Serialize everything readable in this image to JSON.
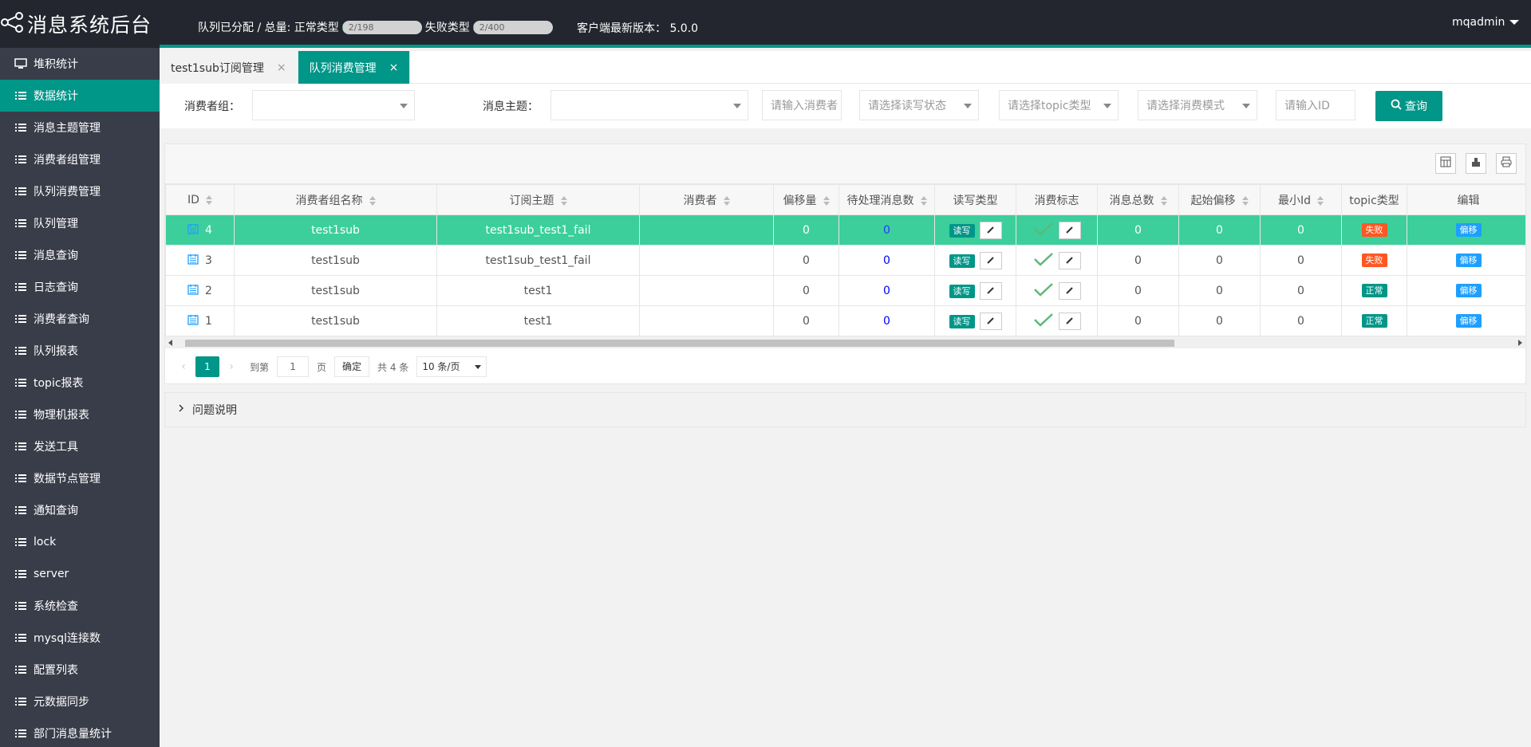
{
  "header": {
    "title": "消息系统后台",
    "queue_label": "队列已分配 / 总量: 正常类型",
    "normal_progress": {
      "text": "2/198",
      "value": 0.0101
    },
    "fail_label": "失败类型",
    "fail_progress": {
      "text": "2/400",
      "value": 0.005
    },
    "version_label": "客户端最新版本： 5.0.0",
    "user": "mqadmin"
  },
  "sidebar": {
    "items": [
      {
        "label": "堆积统计",
        "icon": "monitor-icon",
        "active": false
      },
      {
        "label": "数据统计",
        "icon": "list-icon",
        "active": true
      },
      {
        "label": "消息主题管理",
        "icon": "list-icon",
        "active": false
      },
      {
        "label": "消费者组管理",
        "icon": "list-icon",
        "active": false
      },
      {
        "label": "队列消费管理",
        "icon": "list-icon",
        "active": false
      },
      {
        "label": "队列管理",
        "icon": "list-icon",
        "active": false
      },
      {
        "label": "消息查询",
        "icon": "list-icon",
        "active": false
      },
      {
        "label": "日志查询",
        "icon": "list-icon",
        "active": false
      },
      {
        "label": "消费者查询",
        "icon": "list-icon",
        "active": false
      },
      {
        "label": "队列报表",
        "icon": "list-icon",
        "active": false
      },
      {
        "label": "topic报表",
        "icon": "list-icon",
        "active": false
      },
      {
        "label": "物理机报表",
        "icon": "list-icon",
        "active": false
      },
      {
        "label": "发送工具",
        "icon": "list-icon",
        "active": false
      },
      {
        "label": "数据节点管理",
        "icon": "list-icon",
        "active": false
      },
      {
        "label": "通知查询",
        "icon": "list-icon",
        "active": false
      },
      {
        "label": "lock",
        "icon": "list-icon",
        "active": false
      },
      {
        "label": "server",
        "icon": "list-icon",
        "active": false
      },
      {
        "label": "系统检查",
        "icon": "list-icon",
        "active": false
      },
      {
        "label": "mysql连接数",
        "icon": "list-icon",
        "active": false
      },
      {
        "label": "配置列表",
        "icon": "list-icon",
        "active": false
      },
      {
        "label": "元数据同步",
        "icon": "list-icon",
        "active": false
      },
      {
        "label": "部门消息量统计",
        "icon": "list-icon",
        "active": false
      }
    ]
  },
  "tabs": [
    {
      "label": "test1sub订阅管理",
      "active": false
    },
    {
      "label": "队列消费管理",
      "active": true
    }
  ],
  "search": {
    "consumer_group_label": "消费者组：",
    "topic_label": "消息主题：",
    "consumer_placeholder": "请输入消费者",
    "rw_placeholder": "请选择读写状态",
    "topic_type_placeholder": "请选择topic类型",
    "mode_placeholder": "请选择消费模式",
    "id_placeholder": "请输入ID",
    "button": "查询"
  },
  "table": {
    "columns": [
      "ID",
      "消费者组名称",
      "订阅主题",
      "消费者",
      "偏移量",
      "待处理消息数",
      "读写类型",
      "消费标志",
      "消息总数",
      "起始偏移",
      "最小Id",
      "topic类型",
      "编辑"
    ],
    "rows": [
      {
        "id": "4",
        "group": "test1sub",
        "topic": "test1sub_test1_fail",
        "consumer": "",
        "offset": "0",
        "pending": "0",
        "rw": "读写",
        "total": "0",
        "start": "0",
        "min_id": "0",
        "topic_type": "失败",
        "edit": "偏移",
        "selected": true
      },
      {
        "id": "3",
        "group": "test1sub",
        "topic": "test1sub_test1_fail",
        "consumer": "",
        "offset": "0",
        "pending": "0",
        "rw": "读写",
        "total": "0",
        "start": "0",
        "min_id": "0",
        "topic_type": "失败",
        "edit": "偏移",
        "selected": false
      },
      {
        "id": "2",
        "group": "test1sub",
        "topic": "test1",
        "consumer": "",
        "offset": "0",
        "pending": "0",
        "rw": "读写",
        "total": "0",
        "start": "0",
        "min_id": "0",
        "topic_type": "正常",
        "edit": "偏移",
        "selected": false
      },
      {
        "id": "1",
        "group": "test1sub",
        "topic": "test1",
        "consumer": "",
        "offset": "0",
        "pending": "0",
        "rw": "读写",
        "total": "0",
        "start": "0",
        "min_id": "0",
        "topic_type": "正常",
        "edit": "偏移",
        "selected": false
      }
    ]
  },
  "pager": {
    "current": "1",
    "goto_label": "到第",
    "page_input": "1",
    "page_unit": "页",
    "confirm": "确定",
    "total": "共 4 条",
    "size": "10 条/页"
  },
  "collapse": {
    "title": "问题说明"
  },
  "colors": {
    "accent": "#009688",
    "header_bg": "#23262e",
    "sidebar_bg": "#393d49",
    "selected_row": "#3ccf9b",
    "fail": "#FF5722",
    "edit": "#1E9FFF"
  }
}
